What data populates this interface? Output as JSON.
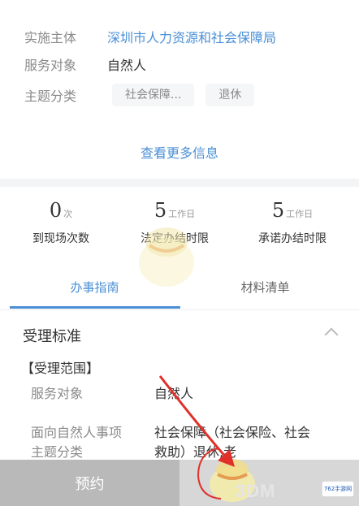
{
  "info": {
    "rows": [
      {
        "label": "实施主体",
        "value": "深圳市人力资源和社会保障局"
      },
      {
        "label": "服务对象",
        "value": "自然人"
      },
      {
        "label": "主题分类",
        "tags": [
          "社会保障...",
          "退休"
        ]
      }
    ],
    "more_link": "查看更多信息"
  },
  "stats": [
    {
      "num": "0",
      "unit": "次",
      "label": "到现场次数"
    },
    {
      "num": "5",
      "unit": "工作日",
      "label": "法定办结时限"
    },
    {
      "num": "5",
      "unit": "工作日",
      "label": "承诺办结时限"
    }
  ],
  "tabs": [
    {
      "label": "办事指南",
      "active": true
    },
    {
      "label": "材料清单",
      "active": false
    }
  ],
  "section": {
    "title": "受理标准",
    "bracket_title": "【受理范围】",
    "rows": [
      {
        "label": "服务对象",
        "value": "自然人"
      },
      {
        "label_lines": [
          "面向自然人事项",
          "主题分类"
        ],
        "value_lines": [
          "社会保障（社会保险、社会",
          "救助）退休,老"
        ]
      }
    ]
  },
  "bottom": {
    "appoint_label": "预约"
  },
  "watermark": {
    "brand": "3DM",
    "site": "762手游网"
  },
  "colors": {
    "accent": "#4a8fd6",
    "annotation_arrow": "#e0302a"
  }
}
